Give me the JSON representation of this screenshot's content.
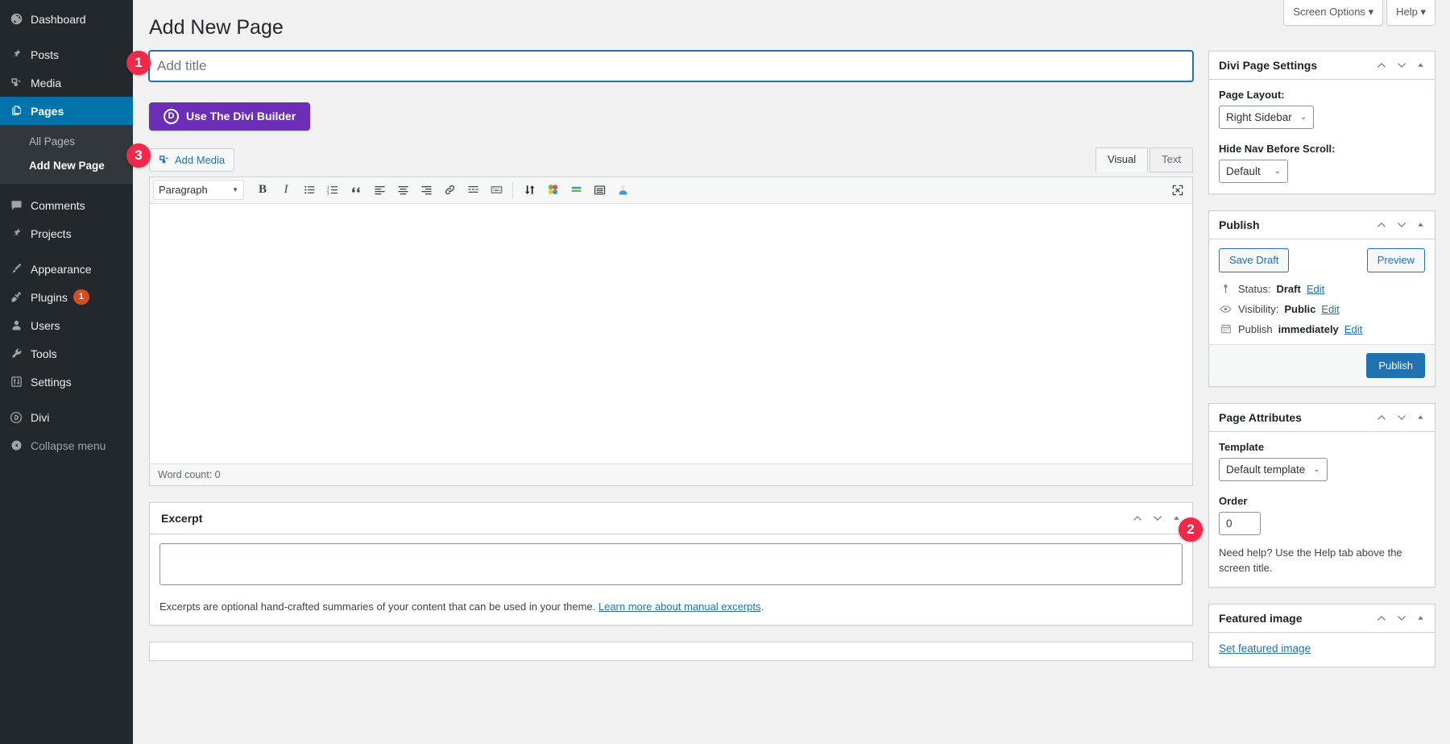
{
  "sidebar": {
    "items": [
      {
        "label": "Dashboard",
        "icon": "dashboard-icon",
        "name": "dashboard"
      },
      {
        "label": "Posts",
        "icon": "pin-icon",
        "name": "posts"
      },
      {
        "label": "Media",
        "icon": "media-icon",
        "name": "media"
      },
      {
        "label": "Pages",
        "icon": "pages-icon",
        "name": "pages",
        "current": true
      },
      {
        "label": "Comments",
        "icon": "comments-icon",
        "name": "comments"
      },
      {
        "label": "Projects",
        "icon": "pin-icon",
        "name": "projects"
      },
      {
        "label": "Appearance",
        "icon": "brush-icon",
        "name": "appearance"
      },
      {
        "label": "Plugins",
        "icon": "plug-icon",
        "name": "plugins",
        "badge": "1"
      },
      {
        "label": "Users",
        "icon": "user-icon",
        "name": "users"
      },
      {
        "label": "Tools",
        "icon": "wrench-icon",
        "name": "tools"
      },
      {
        "label": "Settings",
        "icon": "settings-icon",
        "name": "settings"
      },
      {
        "label": "Divi",
        "icon": "divi-icon",
        "name": "divi"
      },
      {
        "label": "Collapse menu",
        "icon": "collapse-icon",
        "name": "collapse-menu"
      }
    ],
    "submenu": [
      {
        "label": "All Pages",
        "active": false
      },
      {
        "label": "Add New Page",
        "active": true
      }
    ]
  },
  "header": {
    "screen_options": "Screen Options",
    "help": "Help",
    "page_title": "Add New Page"
  },
  "title_field": {
    "value": "",
    "placeholder": "Add title"
  },
  "divi_button": {
    "label": "Use The Divi Builder",
    "glyph": "D",
    "color": "#6c2eb9"
  },
  "editor": {
    "add_media": "Add Media",
    "tabs": [
      {
        "label": "Visual",
        "active": true
      },
      {
        "label": "Text",
        "active": false
      }
    ],
    "format_select": "Paragraph",
    "toolbar_buttons": [
      {
        "name": "bold-icon",
        "glyph": "B"
      },
      {
        "name": "italic-icon",
        "glyph": "I"
      },
      {
        "name": "bulleted-list-icon",
        "glyph": "☰"
      },
      {
        "name": "numbered-list-icon",
        "glyph": "☰"
      },
      {
        "name": "blockquote-icon",
        "glyph": "“"
      },
      {
        "name": "align-left-icon",
        "glyph": "≡"
      },
      {
        "name": "align-center-icon",
        "glyph": "≡"
      },
      {
        "name": "align-right-icon",
        "glyph": "≡"
      },
      {
        "name": "insert-link-icon",
        "glyph": "ὑ7"
      },
      {
        "name": "read-more-icon",
        "glyph": "▤"
      },
      {
        "name": "toolbar-toggle-icon",
        "glyph": "⌸"
      }
    ],
    "plugin_buttons": [
      {
        "name": "sort-arrows-icon"
      },
      {
        "name": "color-blocks-icon"
      },
      {
        "name": "green-bars-icon"
      },
      {
        "name": "lines-icon"
      },
      {
        "name": "lock-person-icon"
      }
    ],
    "fullscreen_icon": "fullscreen-icon",
    "word_count": "Word count: 0"
  },
  "excerpt": {
    "title": "Excerpt",
    "value": "",
    "help_prefix": "Excerpts are optional hand-crafted summaries of your content that can be used in your theme. ",
    "help_link": "Learn more about manual excerpts",
    "help_suffix": "."
  },
  "divi_page_settings": {
    "title": "Divi Page Settings",
    "page_layout_label": "Page Layout:",
    "page_layout_value": "Right Sidebar",
    "hide_nav_label": "Hide Nav Before Scroll:",
    "hide_nav_value": "Default"
  },
  "publish": {
    "title": "Publish",
    "save_draft": "Save Draft",
    "preview": "Preview",
    "status_label": "Status:",
    "status_value": "Draft",
    "visibility_label": "Visibility:",
    "visibility_value": "Public",
    "publish_label": "Publish",
    "publish_value": "immediately",
    "edit": "Edit",
    "publish_button": "Publish"
  },
  "page_attributes": {
    "title": "Page Attributes",
    "template_label": "Template",
    "template_value": "Default template",
    "order_label": "Order",
    "order_value": "0",
    "hint": "Need help? Use the Help tab above the screen title."
  },
  "featured_image": {
    "title": "Featured image",
    "set_link": "Set featured image"
  },
  "steps": [
    {
      "number": "1",
      "target": "title-input"
    },
    {
      "number": "2",
      "target": "template-select"
    },
    {
      "number": "3",
      "target": "divi-builder-button"
    }
  ],
  "colors": {
    "accent_blue": "#2271b1",
    "sidebar_bg": "#23282d",
    "divi_purple": "#6c2eb9",
    "badge_red": "#f0284a"
  }
}
